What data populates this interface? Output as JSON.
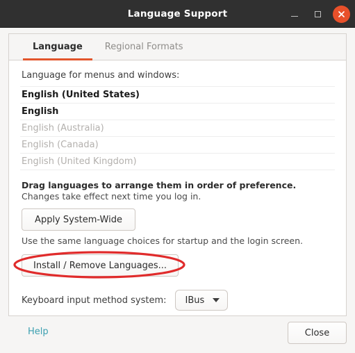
{
  "window": {
    "title": "Language Support",
    "controls": {
      "minimize_label": "Minimize",
      "maximize_label": "Maximize",
      "close_label": "Close window"
    },
    "colors": {
      "titlebar_bg": "#303030",
      "close_button": "#e8502a",
      "accent": "#e2552c",
      "link": "#3b9fb0",
      "highlight_annotation": "#e02b2b"
    }
  },
  "tabs": [
    {
      "label": "Language",
      "active": true
    },
    {
      "label": "Regional Formats",
      "active": false
    }
  ],
  "panel": {
    "section_label": "Language for menus and windows:",
    "languages": [
      {
        "name": "English (United States)",
        "state": "enabled"
      },
      {
        "name": "English",
        "state": "enabled"
      },
      {
        "name": "English (Australia)",
        "state": "disabled"
      },
      {
        "name": "English (Canada)",
        "state": "disabled"
      },
      {
        "name": "English (United Kingdom)",
        "state": "disabled"
      }
    ],
    "hint_strong": "Drag languages to arrange them in order of preference.",
    "hint": "Changes take effect next time you log in.",
    "apply_button": "Apply System-Wide",
    "apply_hint": "Use the same language choices for startup and the login screen.",
    "install_button": "Install / Remove Languages...",
    "ime_label": "Keyboard input method system:",
    "ime_value": "IBus"
  },
  "actions": {
    "help_label": "Help",
    "close_label": "Close"
  }
}
